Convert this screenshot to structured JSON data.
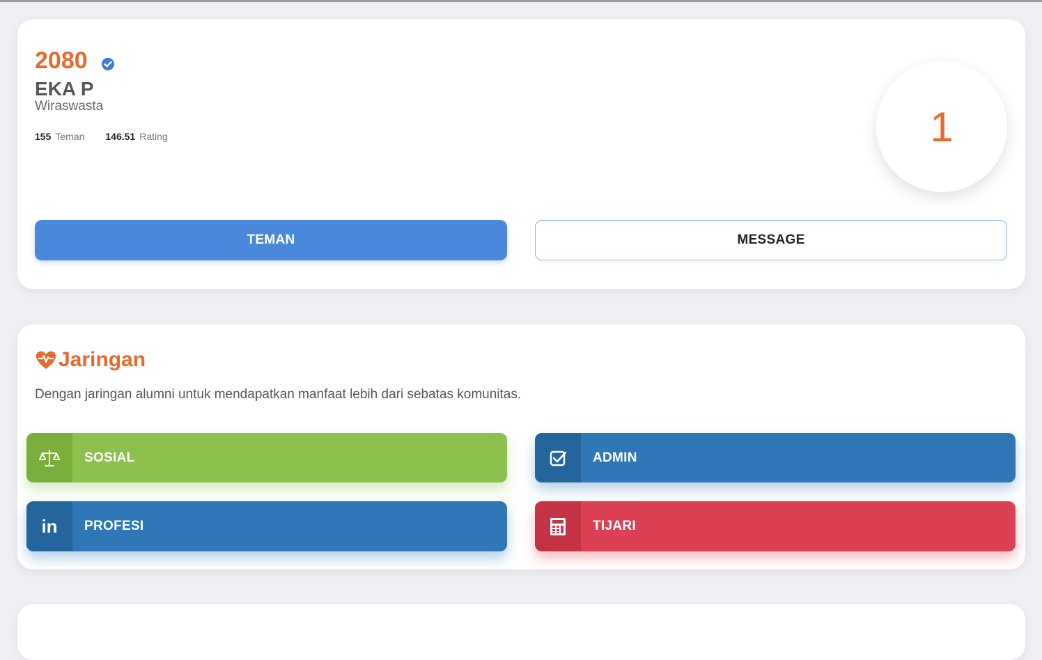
{
  "profile": {
    "member_number": "2080",
    "name": "EKA P",
    "occupation": "Wiraswasta",
    "friends_count": "155",
    "friends_label": "Teman",
    "rating_value": "146.51",
    "rating_label": "Rating",
    "score": "1",
    "teman_button": "TEMAN",
    "message_button": "MESSAGE"
  },
  "network": {
    "title": "Jaringan",
    "description": "Dengan jaringan alumni untuk mendapatkan manfaat lebih dari sebatas komunitas.",
    "buttons": {
      "sosial": "SOSIAL",
      "admin": "ADMIN",
      "profesi": "PROFESI",
      "tijari": "TIJARI"
    },
    "linkedin_glyph": "in"
  },
  "colors": {
    "accent_orange": "#e8692a",
    "primary_blue": "#4a88dc",
    "sosial_green": "#8bc14c",
    "admin_blue": "#2f77b7",
    "tijari_red": "#db4152"
  },
  "icons": {
    "verified": "verified-badge-icon",
    "network": "heart-pulse-icon",
    "sosial": "scale-balance-icon",
    "admin": "checkbox-icon",
    "profesi": "linkedin-icon",
    "tijari": "calculator-icon"
  }
}
